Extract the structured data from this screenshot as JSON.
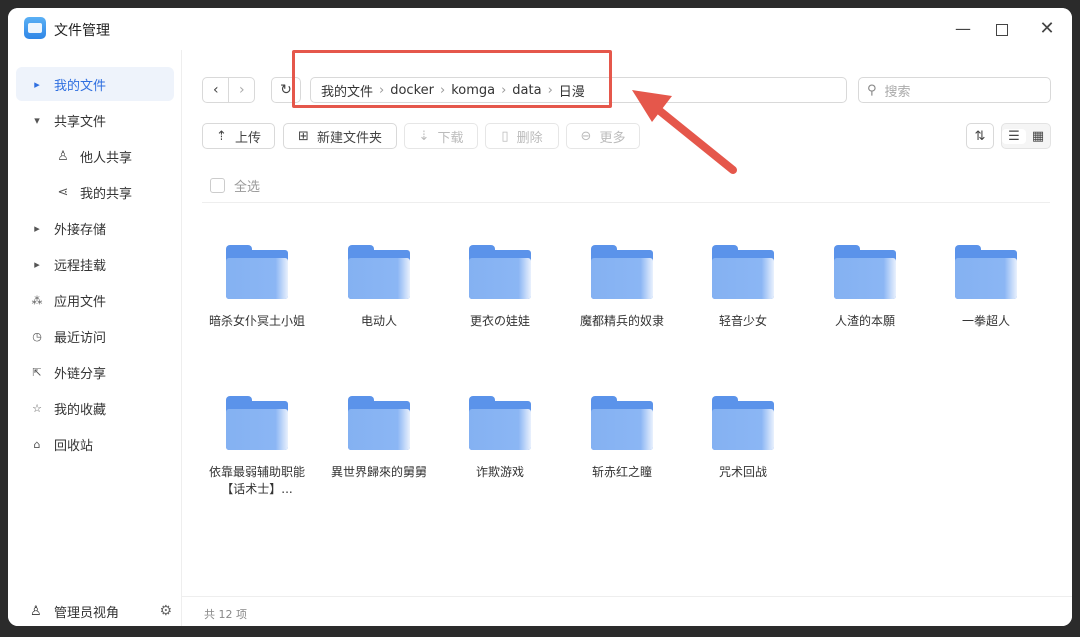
{
  "app": {
    "title": "文件管理"
  },
  "window_controls": {
    "minimize": "—",
    "close": "✕"
  },
  "sidebar": {
    "items": [
      {
        "label": "我的文件",
        "icon": "caret-right-icon",
        "glyph": "▸",
        "active": true
      },
      {
        "label": "共享文件",
        "icon": "caret-down-icon",
        "glyph": "▾"
      },
      {
        "label": "他人共享",
        "icon": "user-icon",
        "glyph": "♙",
        "sub": true
      },
      {
        "label": "我的共享",
        "icon": "share-icon",
        "glyph": "⋖",
        "sub": true
      },
      {
        "label": "外接存储",
        "icon": "caret-right-icon",
        "glyph": "▸"
      },
      {
        "label": "远程挂载",
        "icon": "caret-right-icon",
        "glyph": "▸"
      },
      {
        "label": "应用文件",
        "icon": "apps-icon",
        "glyph": "⁂"
      },
      {
        "label": "最近访问",
        "icon": "clock-icon",
        "glyph": "◷"
      },
      {
        "label": "外链分享",
        "icon": "external-link-icon",
        "glyph": "⇱"
      },
      {
        "label": "我的收藏",
        "icon": "star-icon",
        "glyph": "☆"
      },
      {
        "label": "回收站",
        "icon": "trash-icon",
        "glyph": "⌂"
      }
    ],
    "footer": {
      "label": "管理员视角",
      "icon_glyph": "♙",
      "gear_glyph": "⚙"
    }
  },
  "nav": {
    "back": "‹",
    "forward": "›",
    "refresh": "↻"
  },
  "path": {
    "segments": [
      "我的文件",
      "docker",
      "komga",
      "data",
      "日漫"
    ],
    "separator": "›"
  },
  "search": {
    "placeholder": "搜索",
    "icon_glyph": "⚲"
  },
  "toolbar": {
    "upload": {
      "label": "上传",
      "glyph": "⇡"
    },
    "new_folder": {
      "label": "新建文件夹",
      "glyph": "⊞"
    },
    "download": {
      "label": "下载",
      "glyph": "⇣"
    },
    "delete": {
      "label": "删除",
      "glyph": "▯"
    },
    "more": {
      "label": "更多",
      "glyph": "⊖"
    },
    "sort_glyph": "⇅",
    "list_view_glyph": "☰",
    "grid_view_glyph": "▦"
  },
  "select_all": "全选",
  "folders": [
    {
      "name": "暗杀女仆冥土小姐"
    },
    {
      "name": "电动人"
    },
    {
      "name": "更衣の娃娃"
    },
    {
      "name": "魔都精兵的奴隶"
    },
    {
      "name": "轻音少女"
    },
    {
      "name": "人渣的本願"
    },
    {
      "name": "一拳超人"
    },
    {
      "name": "依靠最弱辅助职能【话术士】..."
    },
    {
      "name": "異世界歸來的舅舅"
    },
    {
      "name": "诈欺游戏"
    },
    {
      "name": "斩赤红之瞳"
    },
    {
      "name": "咒术回战"
    }
  ],
  "status": {
    "count_text": "共 12 项"
  },
  "colors": {
    "accent": "#2f6fe0",
    "folder": "#5b93ea",
    "annotation": "#e5574b"
  }
}
